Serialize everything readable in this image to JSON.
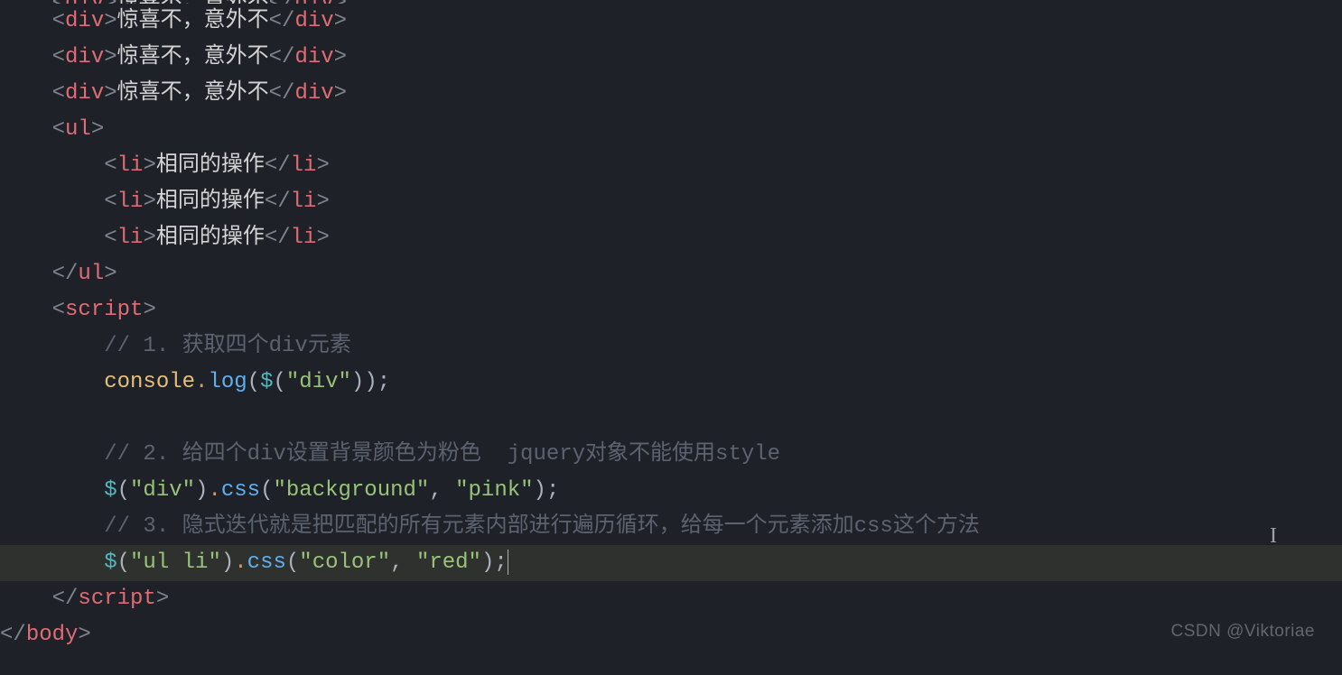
{
  "watermark": "CSDN @Viktoriae",
  "code": {
    "pad0": "    ",
    "pad1": "        ",
    "div_text": "惊喜不，意外不",
    "li_text": "相同的操作",
    "tags": {
      "div": "div",
      "ul": "ul",
      "li": "li",
      "script": "script",
      "body": "body"
    },
    "comment1": "// 1. 获取四个div元素",
    "console": "console",
    "log": "log",
    "dollar": "$",
    "div_sel": "\"div\"",
    "comment2": "// 2. 给四个div设置背景颜色为粉色  jquery对象不能使用style",
    "css": "css",
    "bg": "\"background\"",
    "pink": "\"pink\"",
    "comment3": "// 3. 隐式迭代就是把匹配的所有元素内部进行遍历循环，给每一个元素添加css这个方法",
    "ulli_sel": "\"ul li\"",
    "color": "\"color\"",
    "red": "\"red\""
  }
}
